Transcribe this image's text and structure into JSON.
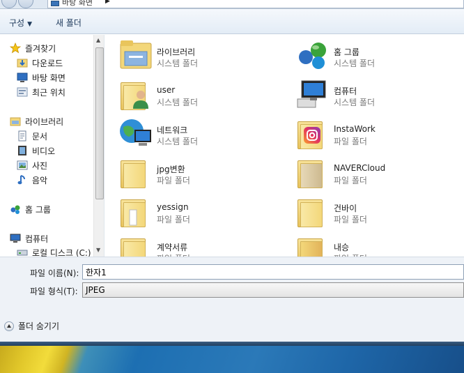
{
  "address": {
    "current": "바탕 화면"
  },
  "toolbar": {
    "organize": "구성",
    "new_folder": "새 폴더"
  },
  "nav": {
    "favorites": {
      "label": "즐겨찾기",
      "items": [
        {
          "label": "다운로드"
        },
        {
          "label": "바탕 화면"
        },
        {
          "label": "최근 위치"
        }
      ]
    },
    "libraries": {
      "label": "라이브러리",
      "items": [
        {
          "label": "문서"
        },
        {
          "label": "비디오"
        },
        {
          "label": "사진"
        },
        {
          "label": "음악"
        }
      ]
    },
    "homegroup": {
      "label": "홈 그룹"
    },
    "computer": {
      "label": "컴퓨터",
      "items": [
        {
          "label": "로컬 디스크 (C:)"
        }
      ]
    }
  },
  "items": [
    {
      "name": "라이브러리",
      "type": "시스템 폴더",
      "icon": "library-icon"
    },
    {
      "name": "홈 그룹",
      "type": "시스템 폴더",
      "icon": "homegroup-icon"
    },
    {
      "name": "user",
      "type": "시스템 폴더",
      "icon": "user-folder-icon"
    },
    {
      "name": "컴퓨터",
      "type": "시스템 폴더",
      "icon": "computer-icon"
    },
    {
      "name": "네트워크",
      "type": "시스템 폴더",
      "icon": "network-icon"
    },
    {
      "name": "InstaWork",
      "type": "파일 폴더",
      "icon": "instagram-folder-icon"
    },
    {
      "name": "jpg변환",
      "type": "파일 폴더",
      "icon": "folder-icon"
    },
    {
      "name": "NAVERCloud",
      "type": "파일 폴더",
      "icon": "folder-icon"
    },
    {
      "name": "yessign",
      "type": "파일 폴더",
      "icon": "folder-icon"
    },
    {
      "name": "건바이",
      "type": "파일 폴더",
      "icon": "folder-icon"
    },
    {
      "name": "계약서류",
      "type": "파일 폴더",
      "icon": "folder-icon"
    },
    {
      "name": "내승",
      "type": "파일 폴더",
      "icon": "folder-icon"
    }
  ],
  "form": {
    "filename_label": "파일 이름(N):",
    "filename_value": "한자1",
    "filetype_label": "파일 형식(T):",
    "filetype_value": "JPEG",
    "hide_folders": "폴더 숨기기"
  },
  "colors": {
    "toolbar_text": "#1e395b",
    "secondary_text": "#7a7a7a",
    "folder_yellow": "#f3d77a"
  }
}
